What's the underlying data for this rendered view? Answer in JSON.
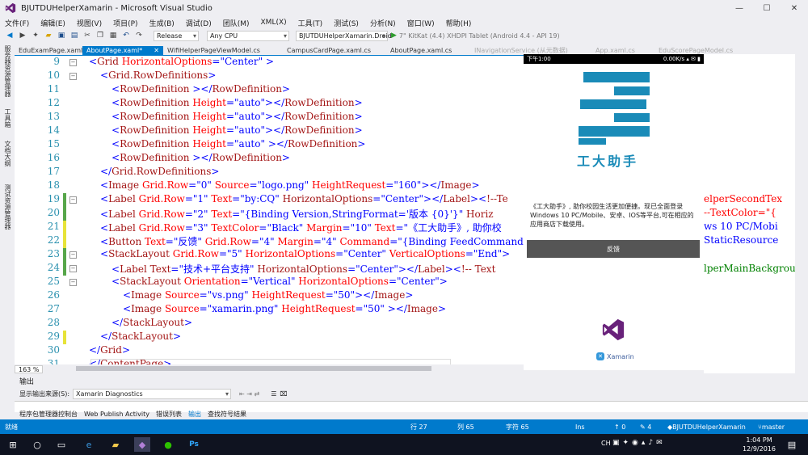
{
  "window": {
    "title": "BJUTDUHelperXamarin - Microsoft Visual Studio"
  },
  "menu": [
    "文件(F)",
    "编辑(E)",
    "视图(V)",
    "项目(P)",
    "生成(B)",
    "调试(D)",
    "团队(M)",
    "XML(X)",
    "工具(T)",
    "测试(S)",
    "分析(N)",
    "窗口(W)",
    "帮助(H)"
  ],
  "toolbar": {
    "config": "Release",
    "platform": "Any CPU",
    "project": "BJUTDUHelperXamarin.Droid",
    "run_target": "7\" KitKat (4.4) XHDPI Tablet (Android 4.4 - API 19)"
  },
  "left_tabs": [
    "服务器资源管理器",
    "工具箱",
    "文档大纲",
    "测试资源管理器"
  ],
  "doc_tabs": [
    {
      "label": "EduExamPage.xaml",
      "active": false
    },
    {
      "label": "AboutPage.xaml*",
      "active": true
    },
    {
      "label": "WifiHelperPageViewModel.cs",
      "active": false
    },
    {
      "label": "CampusCardPage.xaml.cs",
      "active": false
    },
    {
      "label": "AboutPage.xaml.cs",
      "active": false
    },
    {
      "label": "INavigationService (从元数据)",
      "active": false
    },
    {
      "label": "App.xaml.cs",
      "active": false
    },
    {
      "label": "EduScorePageModel.cs",
      "active": false
    }
  ],
  "code_lines": [
    {
      "n": "9",
      "indent": 0,
      "text": "<Grid HorizontalOptions=\"Center\" >"
    },
    {
      "n": "10",
      "indent": 1,
      "text": "<Grid.RowDefinitions>"
    },
    {
      "n": "11",
      "indent": 2,
      "text": "<RowDefinition ></RowDefinition>"
    },
    {
      "n": "12",
      "indent": 2,
      "text": "<RowDefinition Height=\"auto\"></RowDefinition>"
    },
    {
      "n": "13",
      "indent": 2,
      "text": "<RowDefinition Height=\"auto\"></RowDefinition>"
    },
    {
      "n": "14",
      "indent": 2,
      "text": "<RowDefinition Height=\"auto\"></RowDefinition>"
    },
    {
      "n": "15",
      "indent": 2,
      "text": "<RowDefinition Height=\"auto\" ></RowDefinition>"
    },
    {
      "n": "16",
      "indent": 2,
      "text": "<RowDefinition ></RowDefinition>"
    },
    {
      "n": "17",
      "indent": 1,
      "text": "</Grid.RowDefinitions>"
    },
    {
      "n": "18",
      "indent": 1,
      "text": "<Image Grid.Row=\"0\" Source=\"logo.png\" HeightRequest=\"160\"></Image>"
    },
    {
      "n": "19",
      "indent": 1,
      "text": "<Label Grid.Row=\"1\" Text=\"by:CQ\"   HorizontalOptions=\"Center\"></Label><!--Te"
    },
    {
      "n": "20",
      "indent": 1,
      "text": "<Label Grid.Row=\"2\" Text=\"{Binding Version,StringFormat='版本 {0}'}\"   Horiz"
    },
    {
      "n": "21",
      "indent": 1,
      "text": "<Label Grid.Row=\"3\" TextColor=\"Black\" Margin=\"10\" Text=\"《工大助手》, 助你校"
    },
    {
      "n": "22",
      "indent": 1,
      "text": "<Button Text=\"反馈\" Grid.Row=\"4\" Margin=\"4\" Command=\"{Binding FeedCommand}\""
    },
    {
      "n": "23",
      "indent": 1,
      "text": "<StackLayout Grid.Row=\"5\" HorizontalOptions=\"Center\" VerticalOptions=\"End\">"
    },
    {
      "n": "24",
      "indent": 2,
      "text": "<Label  Text=\"技术+平台支持\"  HorizontalOptions=\"Center\"></Label><!-- Text"
    },
    {
      "n": "25",
      "indent": 2,
      "text": "<StackLayout Orientation=\"Vertical\" HorizontalOptions=\"Center\">"
    },
    {
      "n": "26",
      "indent": 3,
      "text": "<Image Source=\"vs.png\" HeightRequest=\"50\"></Image>"
    },
    {
      "n": "27",
      "indent": 3,
      "text": "<Image Source=\"xamarin.png\" HeightRequest=\"50\" ></Image>"
    },
    {
      "n": "28",
      "indent": 2,
      "text": "</StackLayout>"
    },
    {
      "n": "29",
      "indent": 1,
      "text": "</StackLayout>"
    },
    {
      "n": "30",
      "indent": 0,
      "text": "</Grid>"
    },
    {
      "n": "31",
      "indent": 0,
      "text": "</ContentPage>"
    }
  ],
  "right_overflow": [
    "elperSecondTex",
    "--TextColor=\"{",
    "ws 10 PC/Mobi",
    "StaticResource",
    "lperMainBackgrou"
  ],
  "editor": {
    "zoom": "163 %"
  },
  "phone": {
    "status_time": "下午1:00",
    "status_right": "0.00K/s",
    "logo_text": "工大助手",
    "description": "《工大助手》, 助你校园生活更加便捷。现已全面登录Windows 10 PC/Mobile、安卓、IOS等平台,可在相应的应用商店下载使用。",
    "feedback_label": "反馈",
    "xamarin_label": "Xamarin"
  },
  "output": {
    "title": "输出",
    "source_label": "显示输出来源(S):",
    "source_value": "Xamarin Diagnostics",
    "tabs": [
      {
        "label": "程序包管理器控制台",
        "active": false
      },
      {
        "label": "Web Publish Activity",
        "active": false
      },
      {
        "label": "错误列表",
        "active": false
      },
      {
        "label": "输出",
        "active": true
      },
      {
        "label": "查找符号结果",
        "active": false
      }
    ]
  },
  "status": {
    "ready": "就绪",
    "row": "行 27",
    "col": "列 65",
    "char": "字符 65",
    "ins": "Ins",
    "up": "↑ 0",
    "pencil": "✎ 4",
    "repo": "BJUTDUHelperXamarin",
    "branch": "master"
  },
  "taskbar": {
    "time": "1:04 PM",
    "date": "12/9/2016",
    "ime": "CH"
  },
  "colors": {
    "accent": "#007acc",
    "vs_purple": "#68217a",
    "logo_blue": "#1a8bb8"
  }
}
